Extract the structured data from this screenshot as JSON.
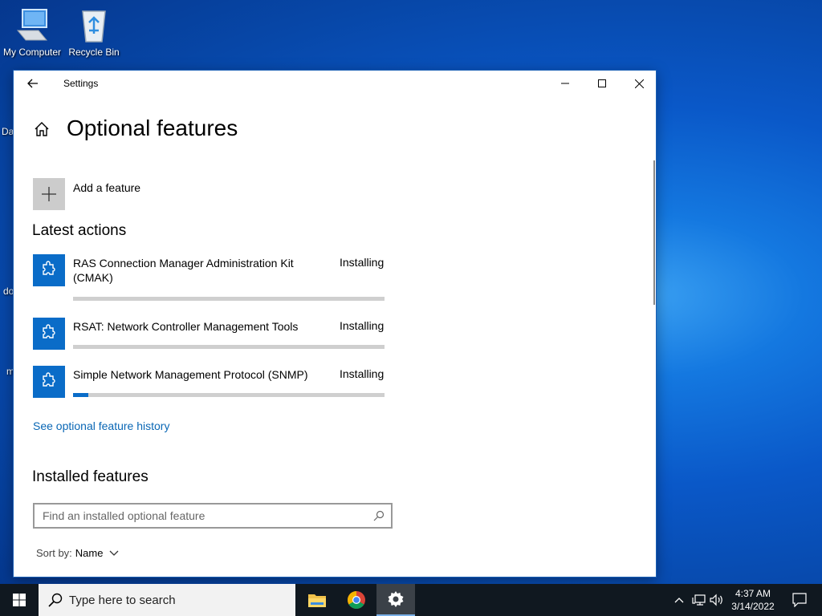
{
  "desktop": {
    "icons": [
      {
        "label": "My Computer",
        "icon": "computer-icon"
      },
      {
        "label": "Recycle Bin",
        "icon": "recycle-bin-icon"
      }
    ],
    "partial_labels": [
      "Da",
      "do",
      "m"
    ]
  },
  "window": {
    "title": "Settings",
    "page_title": "Optional features",
    "add_feature_label": "Add a feature",
    "latest_actions_heading": "Latest actions",
    "features": [
      {
        "name": "RAS Connection Manager Administration Kit (CMAK)",
        "status": "Installing",
        "progress": 0
      },
      {
        "name": "RSAT: Network Controller Management Tools",
        "status": "Installing",
        "progress": 0
      },
      {
        "name": "Simple Network Management Protocol (SNMP)",
        "status": "Installing",
        "progress": 0.05
      }
    ],
    "history_link": "See optional feature history",
    "installed_heading": "Installed features",
    "search_placeholder": "Find an installed optional feature",
    "sort_label": "Sort by:",
    "sort_value": "Name",
    "accent": "#0a6cc8"
  },
  "taskbar": {
    "search_placeholder": "Type here to search",
    "apps": [
      "file-explorer-icon",
      "chrome-icon",
      "settings-icon"
    ],
    "time": "4:37 AM",
    "date": "3/14/2022"
  }
}
